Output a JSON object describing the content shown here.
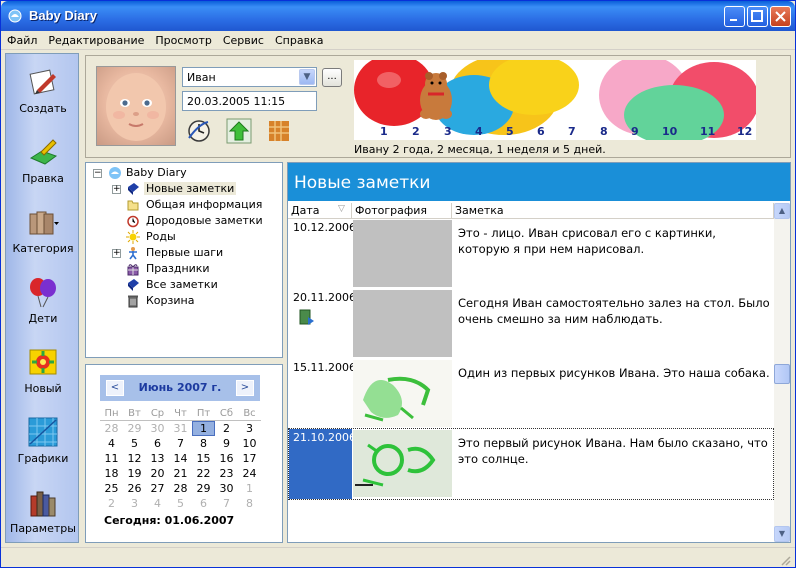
{
  "window": {
    "title": "Baby Diary"
  },
  "menu": [
    "Файл",
    "Редактирование",
    "Просмотр",
    "Сервис",
    "Справка"
  ],
  "sidebar": {
    "items": [
      {
        "label": "Создать",
        "icon": "create-icon"
      },
      {
        "label": "Правка",
        "icon": "edit-icon"
      },
      {
        "label": "Категория",
        "icon": "category-icon"
      },
      {
        "label": "Дети",
        "icon": "children-icon"
      },
      {
        "label": "Новый",
        "icon": "new-icon"
      },
      {
        "label": "Графики",
        "icon": "charts-icon"
      },
      {
        "label": "Параметры",
        "icon": "settings-icon"
      }
    ]
  },
  "profile": {
    "child_name": "Иван",
    "datetime": "20.03.2005 11:15",
    "more_label": "...",
    "age_text": "Ивану 2 года, 2 месяца, 1 неделя и 5 дней.",
    "months": [
      "1",
      "2",
      "3",
      "4",
      "5",
      "6",
      "7",
      "8",
      "9",
      "10",
      "11",
      "12"
    ],
    "current_month": 7
  },
  "tree": {
    "root": "Baby Diary",
    "items": [
      {
        "label": "Новые заметки",
        "expandable": true,
        "selected": true
      },
      {
        "label": "Общая информация",
        "expandable": false
      },
      {
        "label": "Дородовые заметки",
        "expandable": false
      },
      {
        "label": "Роды",
        "expandable": false
      },
      {
        "label": "Первые шаги",
        "expandable": true
      },
      {
        "label": "Праздники",
        "expandable": false
      },
      {
        "label": "Все заметки",
        "expandable": false
      },
      {
        "label": "Корзина",
        "expandable": false
      }
    ]
  },
  "calendar": {
    "title": "Июнь 2007 г.",
    "prev": "<",
    "next": ">",
    "weekdays": [
      "Пн",
      "Вт",
      "Ср",
      "Чт",
      "Пт",
      "Сб",
      "Вс"
    ],
    "weeks": [
      [
        "28",
        "29",
        "30",
        "31",
        "1",
        "2",
        "3"
      ],
      [
        "4",
        "5",
        "6",
        "7",
        "8",
        "9",
        "10"
      ],
      [
        "11",
        "12",
        "13",
        "14",
        "15",
        "16",
        "17"
      ],
      [
        "18",
        "19",
        "20",
        "21",
        "22",
        "23",
        "24"
      ],
      [
        "25",
        "26",
        "27",
        "28",
        "29",
        "30",
        "1"
      ],
      [
        "2",
        "3",
        "4",
        "5",
        "6",
        "7",
        "8"
      ]
    ],
    "today_label": "Сегодня: 01.06.2007"
  },
  "notes": {
    "header": "Новые заметки",
    "columns": {
      "date": "Дата",
      "photo": "Фотография",
      "note": "Заметка"
    },
    "rows": [
      {
        "date": "10.12.2006",
        "text": "Это - лицо. Иван срисовал его с картинки, которую я при нем нарисовал."
      },
      {
        "date": "20.11.2006",
        "text": "Сегодня Иван самостоятельно залез на стол. Было очень смешно за ним наблюдать."
      },
      {
        "date": "15.11.2006",
        "text": "Один из первых рисунков Ивана. Это наша собака."
      },
      {
        "date": "21.10.2006",
        "text": "Это первый рисунок Ивана. Нам было сказано, что это солнце."
      }
    ]
  }
}
